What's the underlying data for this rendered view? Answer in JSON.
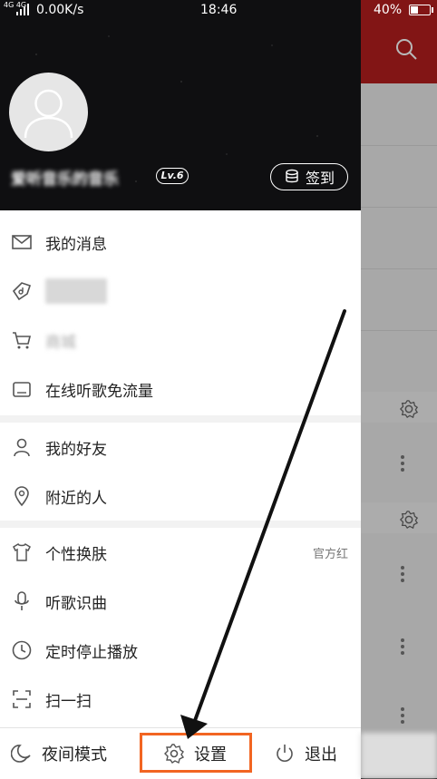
{
  "status_bar": {
    "network": "4G 4G",
    "speed": "0.00K/s",
    "time": "18:46",
    "battery": "40%"
  },
  "profile": {
    "username": "爱听音乐的音乐",
    "level": "Lv.6",
    "checkin_label": "签到"
  },
  "menu": {
    "section1": [
      {
        "label": "我的消息",
        "icon": "mail-icon"
      },
      {
        "label": "",
        "icon": "music-tag-icon"
      },
      {
        "label": "商城",
        "icon": "cart-icon"
      },
      {
        "label": "在线听歌免流量",
        "icon": "sim-card-icon"
      }
    ],
    "section2": [
      {
        "label": "我的好友",
        "icon": "person-icon"
      },
      {
        "label": "附近的人",
        "icon": "location-pin-icon"
      }
    ],
    "section3": [
      {
        "label": "个性换肤",
        "icon": "tshirt-icon",
        "value": "官方红"
      },
      {
        "label": "听歌识曲",
        "icon": "microphone-icon"
      },
      {
        "label": "定时停止播放",
        "icon": "clock-icon"
      },
      {
        "label": "扫一扫",
        "icon": "scan-icon"
      }
    ]
  },
  "bottom_bar": {
    "night_mode": "夜间模式",
    "settings": "设置",
    "logout": "退出"
  },
  "colors": {
    "header_bg": "#0f0f11",
    "accent_red": "#b51e1e",
    "highlight_box": "#f26522"
  }
}
